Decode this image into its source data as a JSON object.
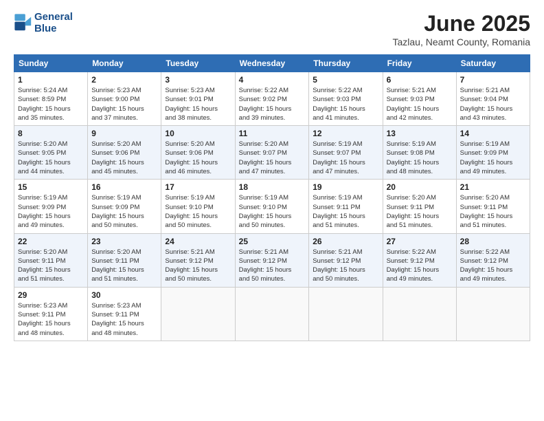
{
  "header": {
    "logo_line1": "General",
    "logo_line2": "Blue",
    "month": "June 2025",
    "location": "Tazlau, Neamt County, Romania"
  },
  "days_of_week": [
    "Sunday",
    "Monday",
    "Tuesday",
    "Wednesday",
    "Thursday",
    "Friday",
    "Saturday"
  ],
  "weeks": [
    [
      {
        "day": "1",
        "info": "Sunrise: 5:24 AM\nSunset: 8:59 PM\nDaylight: 15 hours\nand 35 minutes."
      },
      {
        "day": "2",
        "info": "Sunrise: 5:23 AM\nSunset: 9:00 PM\nDaylight: 15 hours\nand 37 minutes."
      },
      {
        "day": "3",
        "info": "Sunrise: 5:23 AM\nSunset: 9:01 PM\nDaylight: 15 hours\nand 38 minutes."
      },
      {
        "day": "4",
        "info": "Sunrise: 5:22 AM\nSunset: 9:02 PM\nDaylight: 15 hours\nand 39 minutes."
      },
      {
        "day": "5",
        "info": "Sunrise: 5:22 AM\nSunset: 9:03 PM\nDaylight: 15 hours\nand 41 minutes."
      },
      {
        "day": "6",
        "info": "Sunrise: 5:21 AM\nSunset: 9:03 PM\nDaylight: 15 hours\nand 42 minutes."
      },
      {
        "day": "7",
        "info": "Sunrise: 5:21 AM\nSunset: 9:04 PM\nDaylight: 15 hours\nand 43 minutes."
      }
    ],
    [
      {
        "day": "8",
        "info": "Sunrise: 5:20 AM\nSunset: 9:05 PM\nDaylight: 15 hours\nand 44 minutes."
      },
      {
        "day": "9",
        "info": "Sunrise: 5:20 AM\nSunset: 9:06 PM\nDaylight: 15 hours\nand 45 minutes."
      },
      {
        "day": "10",
        "info": "Sunrise: 5:20 AM\nSunset: 9:06 PM\nDaylight: 15 hours\nand 46 minutes."
      },
      {
        "day": "11",
        "info": "Sunrise: 5:20 AM\nSunset: 9:07 PM\nDaylight: 15 hours\nand 47 minutes."
      },
      {
        "day": "12",
        "info": "Sunrise: 5:19 AM\nSunset: 9:07 PM\nDaylight: 15 hours\nand 47 minutes."
      },
      {
        "day": "13",
        "info": "Sunrise: 5:19 AM\nSunset: 9:08 PM\nDaylight: 15 hours\nand 48 minutes."
      },
      {
        "day": "14",
        "info": "Sunrise: 5:19 AM\nSunset: 9:09 PM\nDaylight: 15 hours\nand 49 minutes."
      }
    ],
    [
      {
        "day": "15",
        "info": "Sunrise: 5:19 AM\nSunset: 9:09 PM\nDaylight: 15 hours\nand 49 minutes."
      },
      {
        "day": "16",
        "info": "Sunrise: 5:19 AM\nSunset: 9:09 PM\nDaylight: 15 hours\nand 50 minutes."
      },
      {
        "day": "17",
        "info": "Sunrise: 5:19 AM\nSunset: 9:10 PM\nDaylight: 15 hours\nand 50 minutes."
      },
      {
        "day": "18",
        "info": "Sunrise: 5:19 AM\nSunset: 9:10 PM\nDaylight: 15 hours\nand 50 minutes."
      },
      {
        "day": "19",
        "info": "Sunrise: 5:19 AM\nSunset: 9:11 PM\nDaylight: 15 hours\nand 51 minutes."
      },
      {
        "day": "20",
        "info": "Sunrise: 5:20 AM\nSunset: 9:11 PM\nDaylight: 15 hours\nand 51 minutes."
      },
      {
        "day": "21",
        "info": "Sunrise: 5:20 AM\nSunset: 9:11 PM\nDaylight: 15 hours\nand 51 minutes."
      }
    ],
    [
      {
        "day": "22",
        "info": "Sunrise: 5:20 AM\nSunset: 9:11 PM\nDaylight: 15 hours\nand 51 minutes."
      },
      {
        "day": "23",
        "info": "Sunrise: 5:20 AM\nSunset: 9:11 PM\nDaylight: 15 hours\nand 51 minutes."
      },
      {
        "day": "24",
        "info": "Sunrise: 5:21 AM\nSunset: 9:12 PM\nDaylight: 15 hours\nand 50 minutes."
      },
      {
        "day": "25",
        "info": "Sunrise: 5:21 AM\nSunset: 9:12 PM\nDaylight: 15 hours\nand 50 minutes."
      },
      {
        "day": "26",
        "info": "Sunrise: 5:21 AM\nSunset: 9:12 PM\nDaylight: 15 hours\nand 50 minutes."
      },
      {
        "day": "27",
        "info": "Sunrise: 5:22 AM\nSunset: 9:12 PM\nDaylight: 15 hours\nand 49 minutes."
      },
      {
        "day": "28",
        "info": "Sunrise: 5:22 AM\nSunset: 9:12 PM\nDaylight: 15 hours\nand 49 minutes."
      }
    ],
    [
      {
        "day": "29",
        "info": "Sunrise: 5:23 AM\nSunset: 9:11 PM\nDaylight: 15 hours\nand 48 minutes."
      },
      {
        "day": "30",
        "info": "Sunrise: 5:23 AM\nSunset: 9:11 PM\nDaylight: 15 hours\nand 48 minutes."
      },
      {
        "day": "",
        "info": ""
      },
      {
        "day": "",
        "info": ""
      },
      {
        "day": "",
        "info": ""
      },
      {
        "day": "",
        "info": ""
      },
      {
        "day": "",
        "info": ""
      }
    ]
  ]
}
